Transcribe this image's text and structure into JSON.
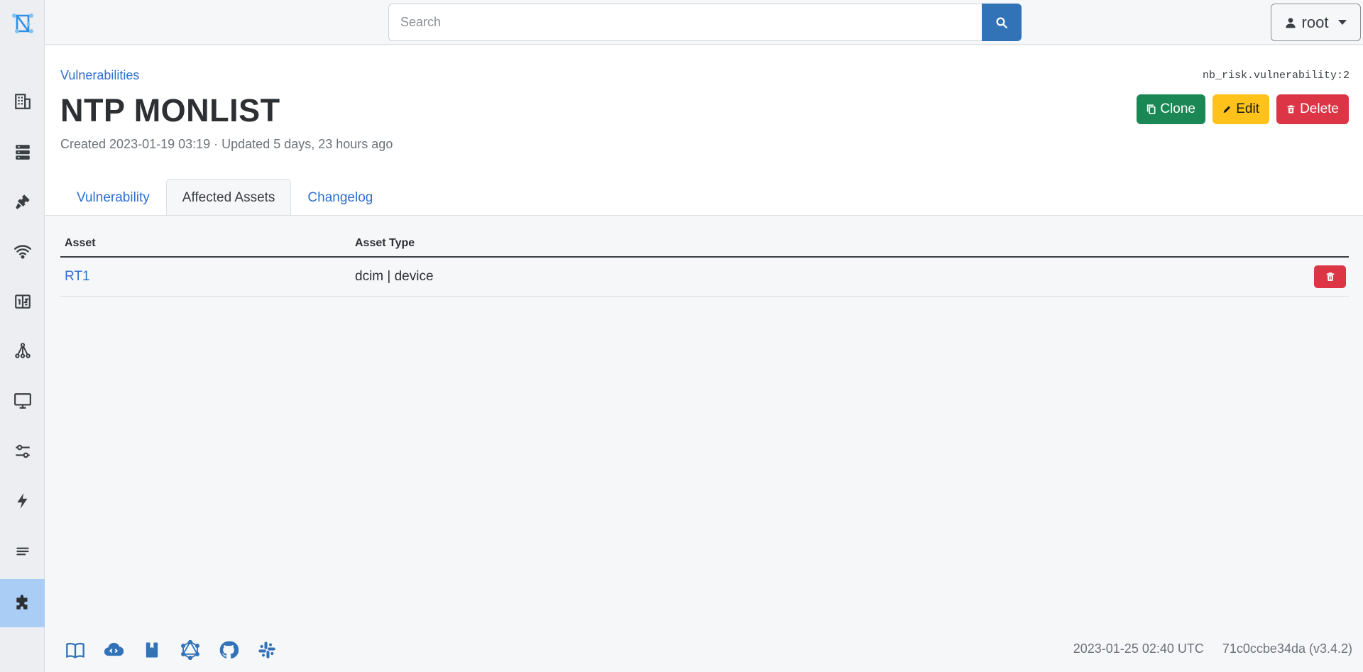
{
  "colors": {
    "primary": "#3273b8",
    "link": "#2f6fcf",
    "success": "#1b8754",
    "warning": "#ffc21a",
    "danger": "#dc3545",
    "sidebar_active": "#a9cdf5"
  },
  "sidebar": {
    "logo": "netbox-logo-icon",
    "items": [
      {
        "icon": "building-icon"
      },
      {
        "icon": "server-icon"
      },
      {
        "icon": "plug-icon"
      },
      {
        "icon": "wifi-icon"
      },
      {
        "icon": "number-icon"
      },
      {
        "icon": "tree-icon"
      },
      {
        "icon": "monitor-icon"
      },
      {
        "icon": "sliders-icon"
      },
      {
        "icon": "lightning-icon"
      },
      {
        "icon": "text-lines-icon"
      },
      {
        "icon": "puzzle-icon",
        "active": true
      }
    ]
  },
  "topbar": {
    "search_placeholder": "Search",
    "search_value": "",
    "user_label": "root"
  },
  "header": {
    "breadcrumb": "Vulnerabilities",
    "object_id": "nb_risk.vulnerability:2",
    "title": "NTP MONLIST",
    "meta": "Created 2023-01-19 03:19 · Updated 5 days, 23 hours ago",
    "clone_label": "Clone",
    "edit_label": "Edit",
    "delete_label": "Delete"
  },
  "tabs": [
    {
      "label": "Vulnerability",
      "active": false
    },
    {
      "label": "Affected Assets",
      "active": true
    },
    {
      "label": "Changelog",
      "active": false
    }
  ],
  "table": {
    "columns": [
      "Asset",
      "Asset Type"
    ],
    "rows": [
      {
        "asset": "RT1",
        "asset_type": "dcim | device"
      }
    ]
  },
  "footer": {
    "icons": [
      "docs-icon",
      "api-icon",
      "book-icon",
      "graphql-icon",
      "github-icon",
      "slack-icon"
    ],
    "timestamp": "2023-01-25 02:40 UTC",
    "version": "71c0ccbe34da (v3.4.2)"
  }
}
